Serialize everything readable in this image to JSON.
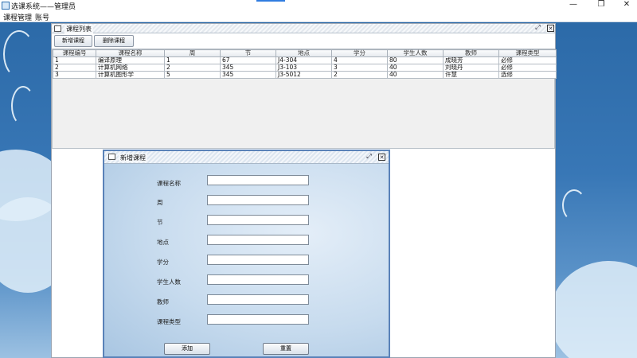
{
  "window": {
    "title": "选课系统——管理员",
    "minimize_glyph": "—",
    "restore_glyph": "❐",
    "close_glyph": "✕"
  },
  "menu": [
    "课程管理",
    "账号"
  ],
  "course_frame": {
    "title": "课程列表",
    "add_button": "新增课程",
    "delete_button": "删除课程",
    "columns": [
      "课程编号",
      "课程名称",
      "周",
      "节",
      "地点",
      "学分",
      "学生人数",
      "教师",
      "课程类型"
    ],
    "rows": [
      [
        "1",
        "编译原理",
        "1",
        "67",
        "J4-304",
        "4",
        "80",
        "成晓芳",
        "必修"
      ],
      [
        "2",
        "计算机网络",
        "2",
        "345",
        "J3-103",
        "3",
        "40",
        "刘晓丹",
        "必修"
      ],
      [
        "3",
        "计算机图形学",
        "5",
        "345",
        "J3-5012",
        "2",
        "40",
        "许慧",
        "选修"
      ]
    ]
  },
  "add_dialog": {
    "title": "新增课程",
    "fields": [
      {
        "label": "课程名称",
        "value": ""
      },
      {
        "label": "周",
        "value": ""
      },
      {
        "label": "节",
        "value": ""
      },
      {
        "label": "地点",
        "value": ""
      },
      {
        "label": "学分",
        "value": ""
      },
      {
        "label": "学生人数",
        "value": ""
      },
      {
        "label": "教师",
        "value": ""
      },
      {
        "label": "课程类型",
        "value": ""
      }
    ],
    "add_button": "添加",
    "reset_button": "重置"
  },
  "colors": {
    "desktop_blue": "#2c6aa8",
    "dialog_border": "#5a82b8",
    "accent": "#2f7ce0"
  }
}
